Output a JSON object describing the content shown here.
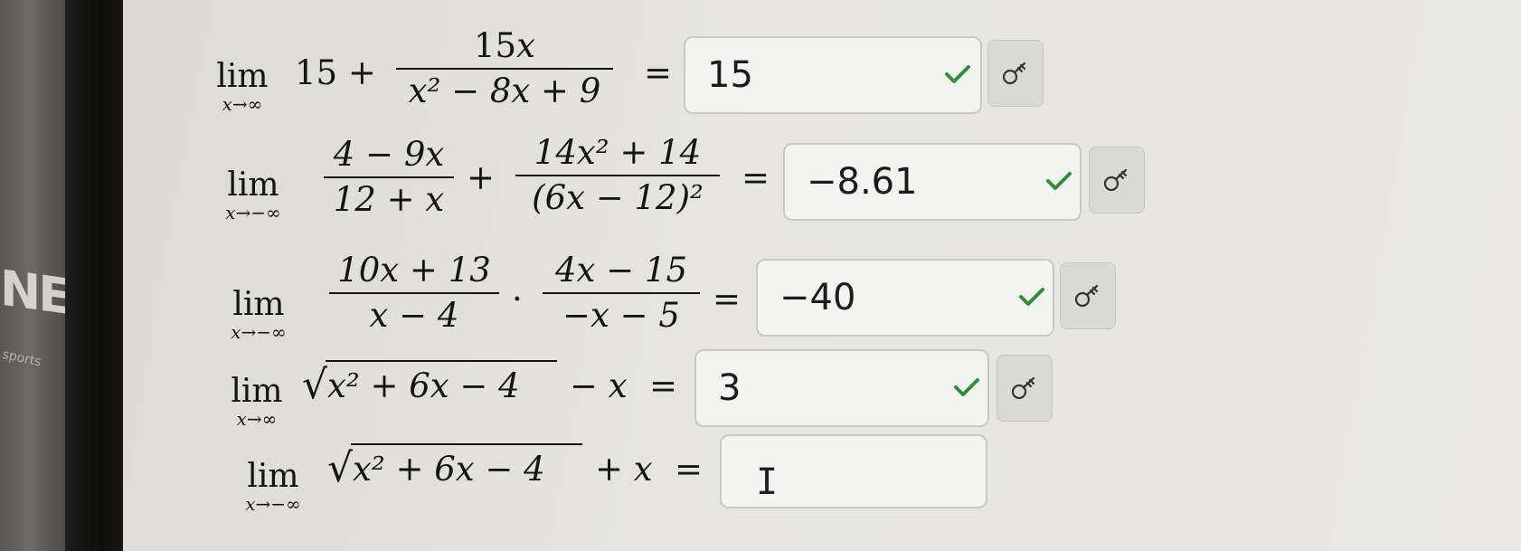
{
  "background_text": {
    "sign_letters": "NE",
    "sign_sub": "sports"
  },
  "colors": {
    "check": "#2f8f3a",
    "box_border": "#c9c9c6",
    "button_bg": "#d9d9d6"
  },
  "problems": [
    {
      "lim_word": "lim",
      "lim_sub": "x→∞",
      "lead": "15 +",
      "frac1_num": "15",
      "frac1_num_var": "x",
      "frac1_den": "x² − 8x + 9",
      "equals": "=",
      "answer": "15",
      "status": "correct"
    },
    {
      "lim_word": "lim",
      "lim_sub": "x→−∞",
      "frac1_num": "4 − 9x",
      "frac1_den": "12 + x",
      "op": "+",
      "frac2_num": "14x² + 14",
      "frac2_den": "(6x − 12)²",
      "equals": "=",
      "answer": "−8.61",
      "status": "correct"
    },
    {
      "lim_word": "lim",
      "lim_sub": "x→−∞",
      "frac1_num": "10x + 13",
      "frac1_den": "x − 4",
      "op": "·",
      "frac2_num": "4x − 15",
      "frac2_den": "−x − 5",
      "equals": "=",
      "answer": "−40",
      "status": "correct"
    },
    {
      "lim_word": "lim",
      "lim_sub": "x→∞",
      "radicand": "x² + 6x − 4",
      "tail": "− x",
      "equals": "=",
      "answer": "3",
      "status": "correct"
    },
    {
      "lim_word": "lim",
      "lim_sub": "x→−∞",
      "radicand": "x² + 6x − 4",
      "tail": "+ x",
      "equals": "=",
      "answer": "",
      "status": "empty"
    }
  ]
}
